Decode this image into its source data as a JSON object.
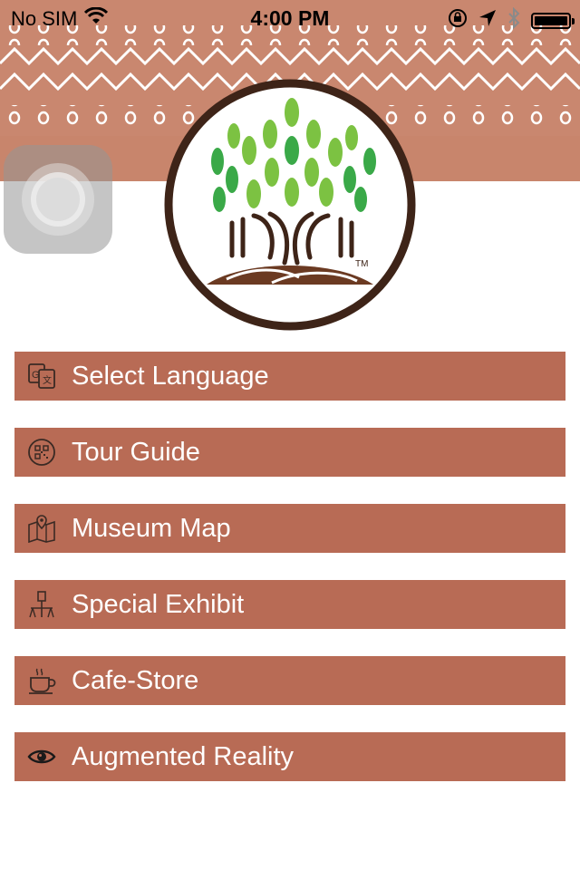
{
  "status_bar": {
    "carrier": "No SIM",
    "time": "4:00 PM",
    "battery_percent": 100,
    "icons": [
      "wifi-icon",
      "orientation-lock-icon",
      "location-arrow-icon",
      "bluetooth-icon",
      "battery-icon"
    ]
  },
  "colors": {
    "banner": "#c9876f",
    "menu_background": "#b86b55",
    "menu_text": "#ffffff",
    "logo_ring": "#3e2418"
  },
  "logo": {
    "trademark": "TM"
  },
  "menu": {
    "items": [
      {
        "label": "Select Language",
        "icon": "translate-icon"
      },
      {
        "label": "Tour Guide",
        "icon": "qr-code-icon"
      },
      {
        "label": "Museum Map",
        "icon": "map-icon"
      },
      {
        "label": "Special Exhibit",
        "icon": "exhibit-icon"
      },
      {
        "label": "Cafe-Store",
        "icon": "coffee-cup-icon"
      },
      {
        "label": "Augmented Reality",
        "icon": "eye-icon"
      }
    ]
  }
}
